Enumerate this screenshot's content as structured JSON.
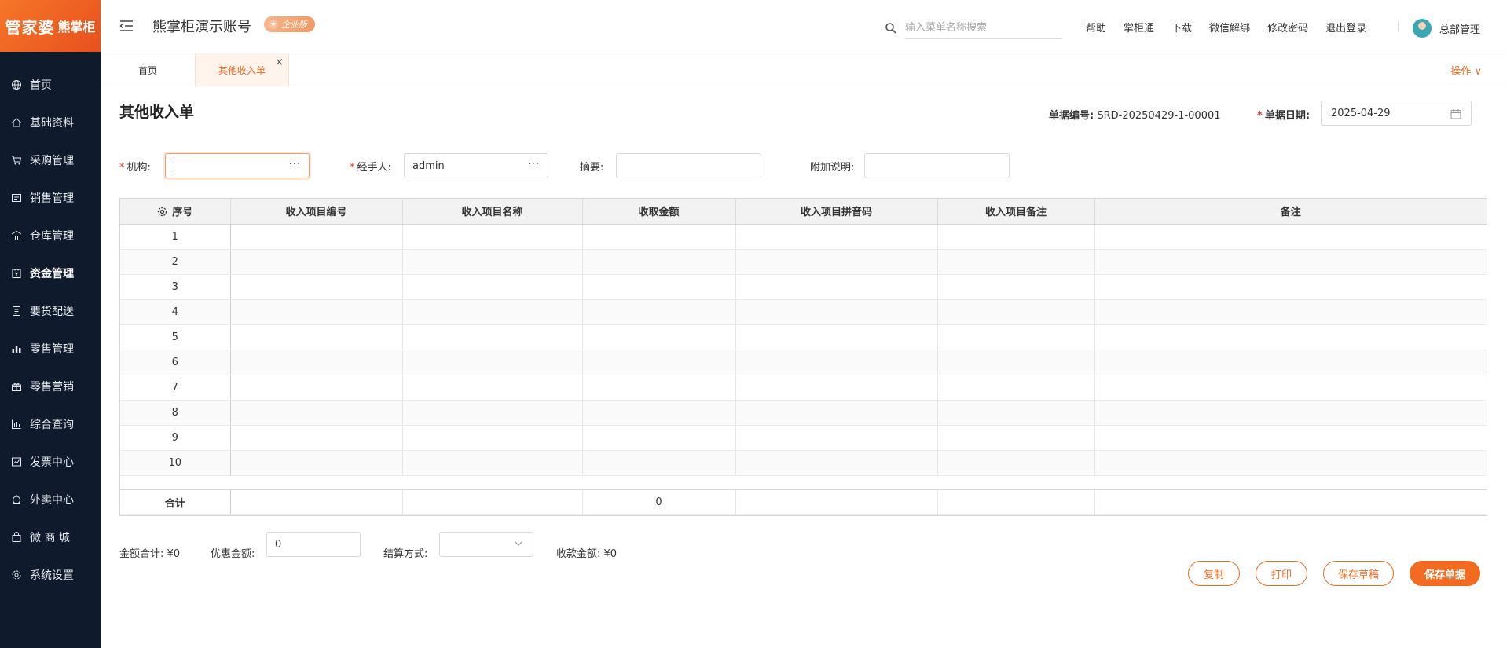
{
  "brand": {
    "logo_main": "管家婆",
    "logo_sub": "熊掌柜"
  },
  "sidebar": {
    "items": [
      {
        "label": "首页",
        "icon": "globe-icon"
      },
      {
        "label": "基础资料",
        "icon": "home-icon"
      },
      {
        "label": "采购管理",
        "icon": "cart-icon"
      },
      {
        "label": "销售管理",
        "icon": "sales-icon"
      },
      {
        "label": "仓库管理",
        "icon": "warehouse-icon"
      },
      {
        "label": "资金管理",
        "icon": "fund-icon"
      },
      {
        "label": "要货配送",
        "icon": "delivery-icon"
      },
      {
        "label": "零售管理",
        "icon": "retail-icon"
      },
      {
        "label": "零售营销",
        "icon": "gift-icon"
      },
      {
        "label": "综合查询",
        "icon": "chart-icon"
      },
      {
        "label": "发票中心",
        "icon": "invoice-icon"
      },
      {
        "label": "外卖中心",
        "icon": "takeout-icon"
      },
      {
        "label": "微 商 城",
        "icon": "shop-icon"
      },
      {
        "label": "系统设置",
        "icon": "gear-icon"
      }
    ],
    "active_index": 5
  },
  "header": {
    "account": "熊掌柜演示账号",
    "edition_badge": "企业版",
    "search_placeholder": "输入菜单名称搜索",
    "links": [
      "帮助",
      "掌柜通",
      "下载",
      "微信解绑",
      "修改密码",
      "退出登录"
    ],
    "user": "总部管理"
  },
  "tabs": {
    "home": "首页",
    "active": "其他收入单",
    "close": "×",
    "ops": "操作 ∨"
  },
  "form": {
    "title": "其他收入单",
    "doc_no_label": "单据编号:",
    "doc_no": "SRD-20250429-1-00001",
    "doc_date_label": "单据日期:",
    "doc_date": "2025-04-29",
    "org_label": "机构:",
    "org_value": "",
    "handler_label": "经手人:",
    "handler_value": "admin",
    "summary_label": "摘要:",
    "summary_value": "",
    "note_label": "附加说明:",
    "note_value": ""
  },
  "grid": {
    "columns": [
      "序号",
      "收入项目编号",
      "收入项目名称",
      "收取金额",
      "收入项目拼音码",
      "收入项目备注",
      "备注"
    ],
    "rows": [
      "1",
      "2",
      "3",
      "4",
      "5",
      "6",
      "7",
      "8",
      "9",
      "10"
    ],
    "total_label": "合计",
    "total_amount": "0"
  },
  "footer": {
    "amount_total": "金额合计: ¥0",
    "discount_label": "优惠金额:",
    "discount_value": "0",
    "settle_label": "结算方式:",
    "settle_value": "",
    "received": "收款金额: ¥0"
  },
  "buttons": {
    "copy": "复制",
    "print": "打印",
    "save_draft": "保存草稿",
    "save": "保存单据"
  },
  "colors": {
    "accent": "#f26b21",
    "sidebar_bg": "#0f1b2d"
  }
}
